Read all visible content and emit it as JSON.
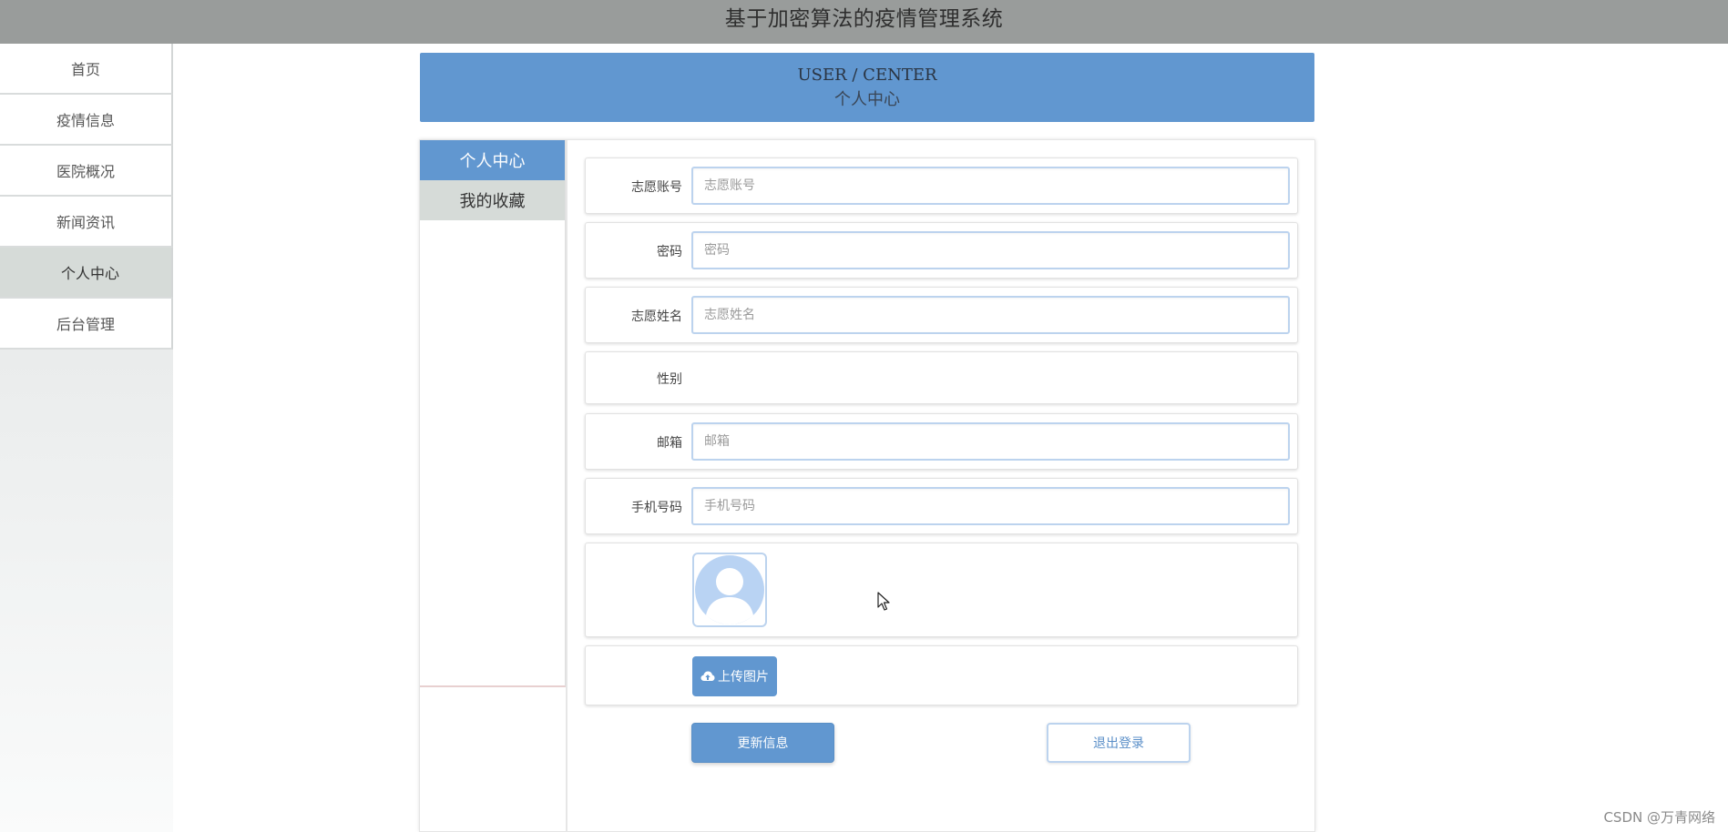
{
  "header": {
    "title": "基于加密算法的疫情管理系统"
  },
  "sidebar": {
    "items": [
      {
        "label": "首页"
      },
      {
        "label": "疫情信息"
      },
      {
        "label": "医院概况"
      },
      {
        "label": "新闻资讯"
      },
      {
        "label": "个人中心",
        "active": true
      },
      {
        "label": "后台管理"
      }
    ]
  },
  "banner": {
    "en": "USER / CENTER",
    "zh": "个人中心"
  },
  "subnav": {
    "items": [
      {
        "label": "个人中心",
        "active": true
      },
      {
        "label": "我的收藏"
      }
    ]
  },
  "form": {
    "account": {
      "label": "志愿账号",
      "placeholder": "志愿账号",
      "value": ""
    },
    "password": {
      "label": "密码",
      "placeholder": "密码",
      "value": ""
    },
    "name": {
      "label": "志愿姓名",
      "placeholder": "志愿姓名",
      "value": ""
    },
    "gender": {
      "label": "性别",
      "value": ""
    },
    "email": {
      "label": "邮箱",
      "placeholder": "邮箱",
      "value": ""
    },
    "phone": {
      "label": "手机号码",
      "placeholder": "手机号码",
      "value": ""
    },
    "upload_label": "上传图片",
    "update_label": "更新信息",
    "logout_label": "退出登录"
  },
  "watermark": "CSDN @万青网络",
  "colors": {
    "header_bg": "#999c9b",
    "accent": "#6197d0",
    "input_border": "#bcd3ee",
    "nav_active_bg": "#d6dbd8"
  },
  "icons": {
    "upload": "cloud-upload-icon",
    "avatar": "user-placeholder-icon",
    "cursor": "mouse-pointer-icon"
  }
}
